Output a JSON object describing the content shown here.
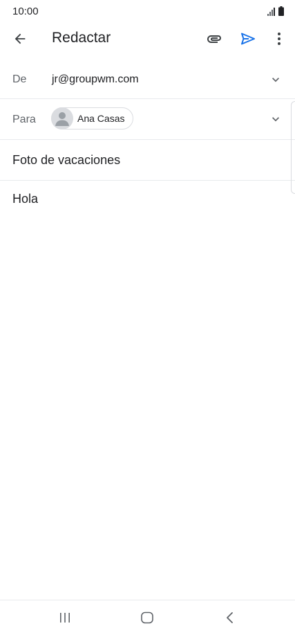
{
  "status_bar": {
    "time": "10:00",
    "signal_icon": "signal-icon",
    "battery_icon": "battery-icon"
  },
  "app_bar": {
    "title": "Redactar",
    "back_icon": "arrow-back-icon",
    "attach_icon": "paperclip-icon",
    "send_icon": "send-icon",
    "more_icon": "more-vert-icon",
    "accent_color": "#1a73e8"
  },
  "from": {
    "label": "De",
    "value": "jr@groupwm.com"
  },
  "to": {
    "label": "Para",
    "recipient": "Ana Casas"
  },
  "subject": {
    "value": "Foto de vacaciones"
  },
  "body": {
    "value": "Hola"
  },
  "nav_bar": {
    "recents_icon": "recents-icon",
    "home_icon": "home-icon",
    "back_icon": "nav-back-icon"
  }
}
